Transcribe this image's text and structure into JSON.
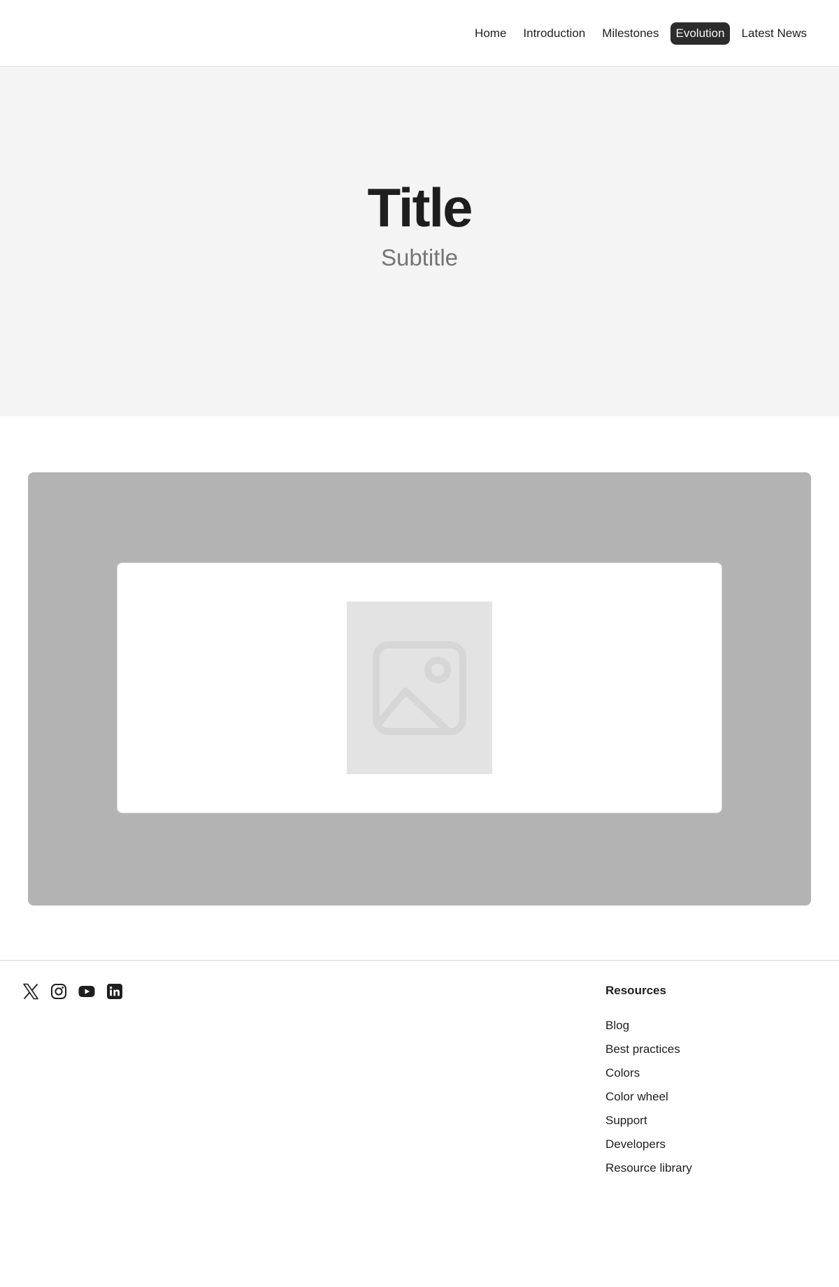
{
  "nav": {
    "items": [
      {
        "label": "Home",
        "active": false
      },
      {
        "label": "Introduction",
        "active": false
      },
      {
        "label": "Milestones",
        "active": false
      },
      {
        "label": "Evolution",
        "active": true
      },
      {
        "label": "Latest News",
        "active": false
      }
    ]
  },
  "hero": {
    "title": "Title",
    "subtitle": "Subtitle"
  },
  "media": {
    "image_icon": "image-placeholder-icon"
  },
  "footer": {
    "social": [
      {
        "icon": "x-icon"
      },
      {
        "icon": "instagram-icon"
      },
      {
        "icon": "youtube-icon"
      },
      {
        "icon": "linkedin-icon"
      }
    ],
    "resources": {
      "heading": "Resources",
      "links": [
        "Blog",
        "Best practices",
        "Colors",
        "Color wheel",
        "Support",
        "Developers",
        "Resource library"
      ]
    }
  },
  "colors": {
    "text": "#1e1e1e",
    "muted": "#757575",
    "hero_bg": "#f4f4f4",
    "panel_bg": "#b3b3b3",
    "active_nav_bg": "#2c2c2c"
  }
}
